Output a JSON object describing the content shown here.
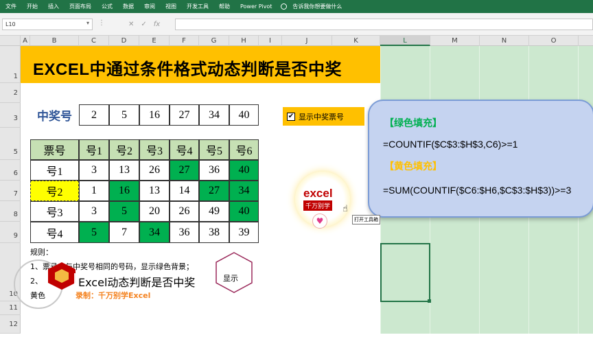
{
  "ribbon": {
    "tabs": [
      "文件",
      "开始",
      "插入",
      "页面布局",
      "公式",
      "数据",
      "审阅",
      "视图",
      "开发工具",
      "帮助",
      "Power Pivot"
    ],
    "tell_me": "告诉我你想要做什么"
  },
  "formula_bar": {
    "name_box": "L10",
    "formula": ""
  },
  "columns": [
    "A",
    "B",
    "C",
    "D",
    "E",
    "F",
    "G",
    "H",
    "I",
    "J",
    "K",
    "L",
    "M",
    "N",
    "O"
  ],
  "rows": [
    "1",
    "2",
    "3",
    "5",
    "6",
    "7",
    "8",
    "9",
    "10",
    "11",
    "12"
  ],
  "sheet": {
    "title": "EXCEL中通过条件格式动态判断是否中奖",
    "winning_label": "中奖号",
    "winning_numbers": [
      "2",
      "5",
      "16",
      "27",
      "34",
      "40"
    ],
    "table_headers": [
      "票号",
      "号1",
      "号2",
      "号3",
      "号4",
      "号5",
      "号6"
    ],
    "tickets": [
      {
        "name": "号1",
        "nums": [
          "3",
          "13",
          "26",
          "27",
          "36",
          "40"
        ]
      },
      {
        "name": "号2",
        "nums": [
          "1",
          "16",
          "13",
          "14",
          "27",
          "34"
        ]
      },
      {
        "name": "号3",
        "nums": [
          "3",
          "5",
          "20",
          "26",
          "49",
          "40"
        ]
      },
      {
        "name": "号4",
        "nums": [
          "5",
          "7",
          "34",
          "36",
          "38",
          "39"
        ]
      }
    ],
    "checkbox_label": "显示中奖票号",
    "checkbox_checked": true,
    "rules_title": "规则：",
    "rule1": "1、票号中与中奖号相同的号码，显示绿色背景；",
    "rule2_prefix": "2、",
    "rule2_tail": "黄色"
  },
  "callout": {
    "green_heading": "【绿色填充】",
    "green_formula": "=COUNTIF($C$3:$H$3,C6)>=1",
    "yellow_heading": "【黄色填充】",
    "yellow_formula": "=SUM(COUNTIF($C6:$H6,$C$3:$H$3))>=3"
  },
  "overlay": {
    "logo_main": "excel",
    "logo_sub": "千万别学",
    "tooltip": "打开工具箱",
    "banner_title": "Excel动态判断是否中奖",
    "banner_sub": "录制：千万别学Excel",
    "hex_button": "显示"
  },
  "colors": {
    "excel_green": "#217346",
    "title_fill": "#ffc000",
    "match_fill": "#00b050",
    "header_fill": "#c6e0b4",
    "highlight_fill": "#ffff00"
  }
}
